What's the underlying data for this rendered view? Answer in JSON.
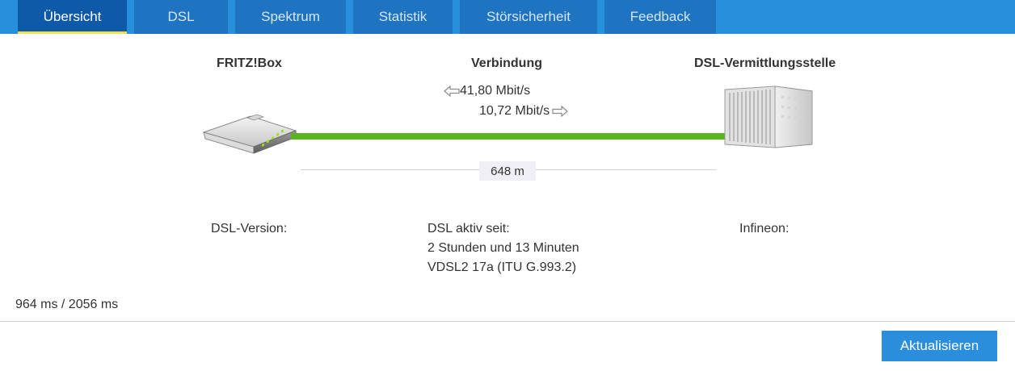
{
  "tabs": [
    {
      "label": "Übersicht"
    },
    {
      "label": "DSL"
    },
    {
      "label": "Spektrum"
    },
    {
      "label": "Statistik"
    },
    {
      "label": "Störsicherheit"
    },
    {
      "label": "Feedback"
    }
  ],
  "active_tab": "Übersicht",
  "diagram": {
    "left_heading": "FRITZ!Box",
    "center_heading": "Verbindung",
    "right_heading": "DSL-Vermittlungsstelle",
    "downstream": "41,80 Mbit/s",
    "upstream": "10,72 Mbit/s",
    "distance": "648 m"
  },
  "info": {
    "dsl_version_label": "DSL-Version:",
    "active_since_label": "DSL aktiv seit:",
    "active_duration": "2 Stunden und 13 Minuten",
    "mode": "VDSL2 17a (ITU G.993.2)",
    "chipset_label": "Infineon:"
  },
  "timing": "964 ms / 2056 ms",
  "refresh_button": "Aktualisieren",
  "colors": {
    "tabbar": "#288fdd",
    "tab": "#1e74c0",
    "tab_active": "#0f5aa8",
    "active_underline": "#f3e14a",
    "connection_line": "#5ab41e",
    "button": "#2b8edc"
  },
  "icons": {
    "downstream_arrow": "arrow-left-outline",
    "upstream_arrow": "arrow-right-outline",
    "router": "fritzbox-router",
    "exchange": "dslam-rack"
  }
}
